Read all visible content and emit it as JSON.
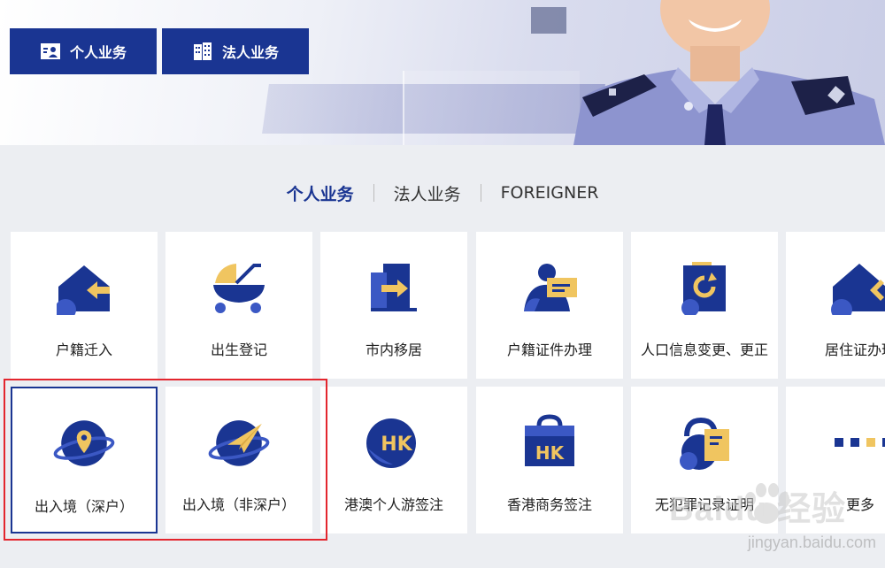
{
  "top_buttons": [
    {
      "label": "个人业务",
      "icon": "person-card-icon"
    },
    {
      "label": "法人业务",
      "icon": "building-icon"
    }
  ],
  "tabs": [
    {
      "label": "个人业务",
      "active": true
    },
    {
      "label": "法人业务",
      "active": false
    },
    {
      "label": "FOREIGNER",
      "active": false
    }
  ],
  "cards": [
    {
      "label": "户籍迁入",
      "icon": "house-arrow-in-icon"
    },
    {
      "label": "出生登记",
      "icon": "baby-stroller-icon"
    },
    {
      "label": "市内移居",
      "icon": "door-arrow-icon"
    },
    {
      "label": "户籍证件办理",
      "icon": "person-id-card-icon"
    },
    {
      "label": "人口信息变更、更正",
      "icon": "document-refresh-icon"
    },
    {
      "label": "居住证办理",
      "icon": "house-person-icon"
    },
    {
      "label": "出入境（深户）",
      "icon": "globe-location-pin-icon"
    },
    {
      "label": "出入境（非深户）",
      "icon": "globe-paper-plane-icon"
    },
    {
      "label": "港澳个人游签注",
      "icon": "hk-globe-icon"
    },
    {
      "label": "香港商务签注",
      "icon": "hk-briefcase-icon"
    },
    {
      "label": "无犯罪记录证明",
      "icon": "lock-document-icon"
    },
    {
      "label": "更多",
      "icon": "more-dots-icon"
    }
  ],
  "watermark": {
    "brand": "Baidu 经验",
    "url": "jingyan.baidu.com"
  },
  "colors": {
    "primary": "#1a3592",
    "accent": "#f0c560",
    "highlight": "#e3262e"
  }
}
